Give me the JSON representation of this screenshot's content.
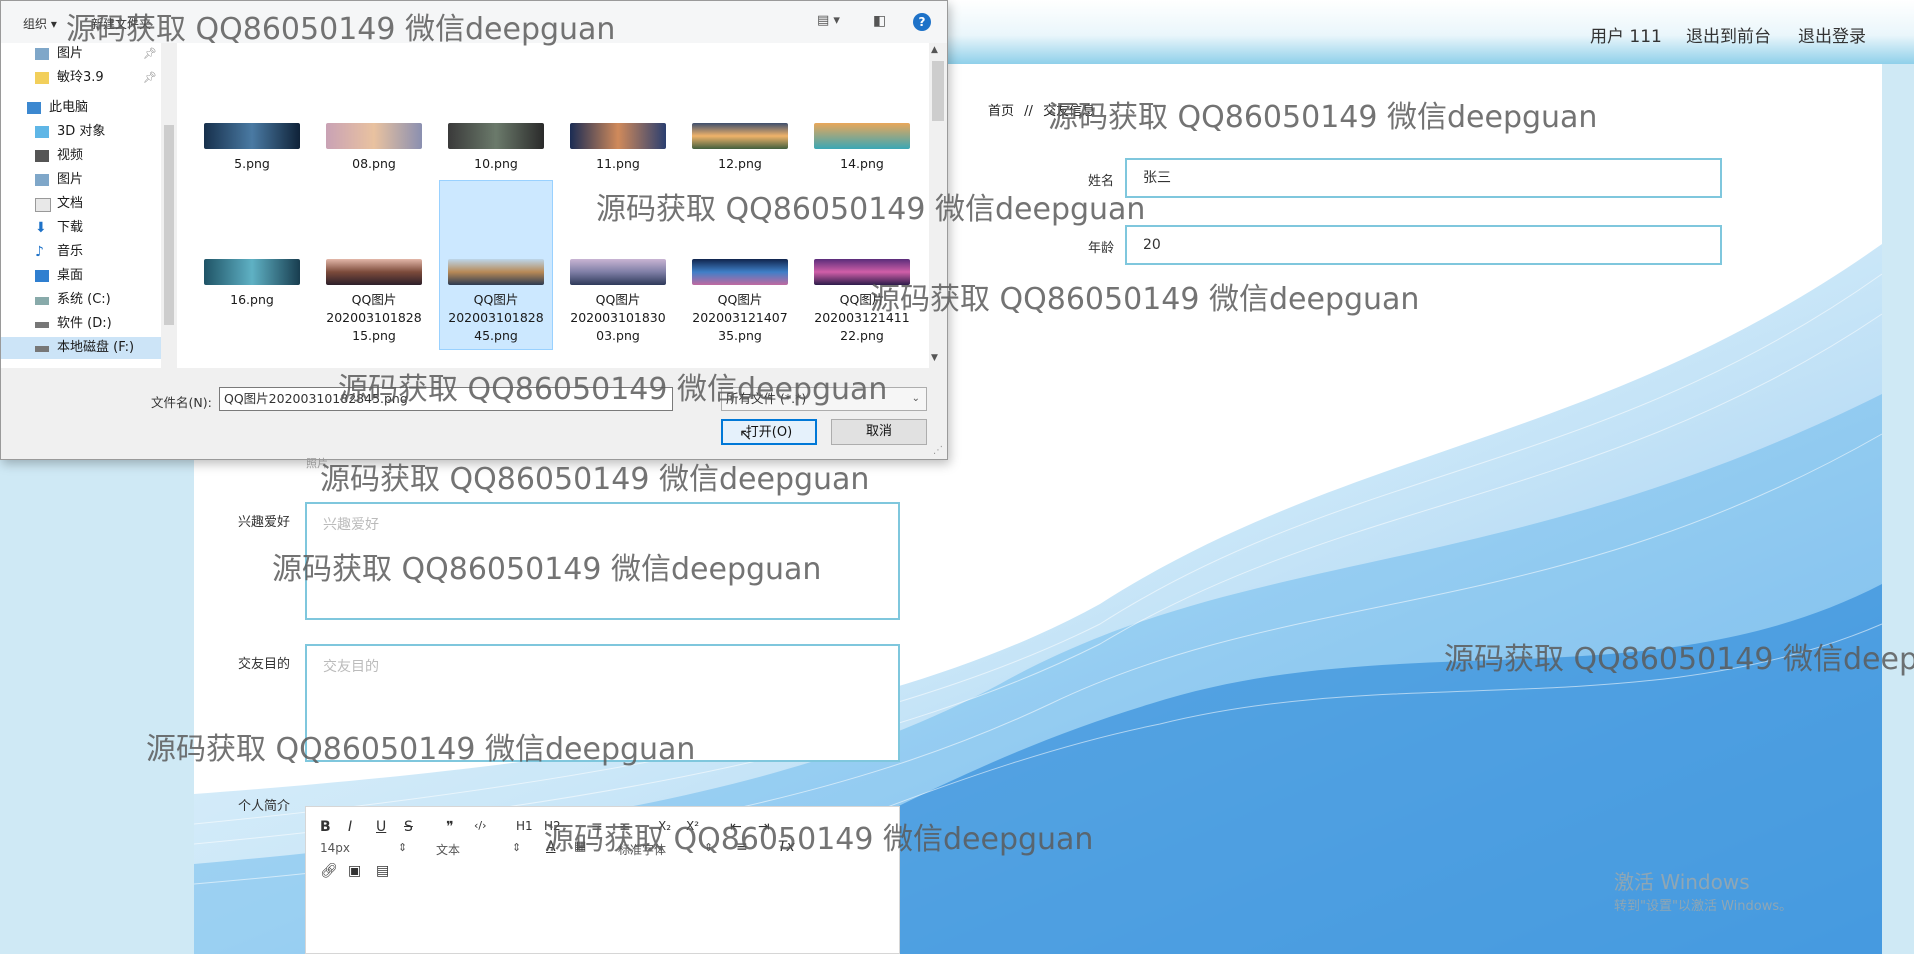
{
  "header": {
    "user": "用户 111",
    "to_front": "退出到前台",
    "logout": "退出登录"
  },
  "breadcrumb": {
    "home": "首页",
    "sep": "//",
    "current": "交友信息"
  },
  "form": {
    "name_label": "姓名",
    "name_value": "张三",
    "age_label": "年龄",
    "age_value": "20",
    "hobby_label": "兴趣爱好",
    "hobby_placeholder": "兴趣爱好",
    "purpose_label": "交友目的",
    "purpose_placeholder": "交友目的",
    "intro_label": "个人简介",
    "photo_label_partial": "照片"
  },
  "editor": {
    "font_size": "14px",
    "para": "文本",
    "font_family": "标准字体",
    "tools": [
      "B",
      "I",
      "U",
      "S",
      "❞",
      "‹/›",
      "H1",
      "H2",
      "≡",
      "≡",
      "X₂",
      "X²",
      "⇤",
      "⇥"
    ]
  },
  "os": {
    "activate_title": "激活 Windows",
    "activate_sub": "转到\"设置\"以激活 Windows。"
  },
  "dialog": {
    "organize": "组织 ▾",
    "new_folder": "新建文件夹",
    "nav": [
      {
        "label": "图片",
        "pinned": true,
        "icon": "pictures-icon"
      },
      {
        "label": "敏玲3.9",
        "pinned": true,
        "icon": "folder-icon"
      },
      {
        "label": "此电脑",
        "icon": "computer-icon"
      },
      {
        "label": "3D 对象",
        "icon": "3d-objects-icon"
      },
      {
        "label": "视频",
        "icon": "video-icon"
      },
      {
        "label": "图片",
        "icon": "pictures-icon"
      },
      {
        "label": "文档",
        "icon": "documents-icon"
      },
      {
        "label": "下载",
        "icon": "download-icon"
      },
      {
        "label": "音乐",
        "icon": "music-icon"
      },
      {
        "label": "桌面",
        "icon": "desktop-icon"
      },
      {
        "label": "系统 (C:)",
        "icon": "drive-icon"
      },
      {
        "label": "软件 (D:)",
        "icon": "drive-icon"
      },
      {
        "label": "本地磁盘 (F:)",
        "icon": "drive-icon"
      }
    ],
    "files_row1": [
      "5.png",
      "08.png",
      "10.png",
      "11.png",
      "12.png",
      "14.png"
    ],
    "files_row2": [
      [
        "16.png"
      ],
      [
        "QQ图片",
        "202003101828",
        "15.png"
      ],
      [
        "QQ图片",
        "202003101828",
        "45.png"
      ],
      [
        "QQ图片",
        "202003101830",
        "03.png"
      ],
      [
        "QQ图片",
        "202003121407",
        "35.png"
      ],
      [
        "QQ图片",
        "202003121411",
        "22.png"
      ]
    ],
    "filename_label": "文件名(N):",
    "filename_value": "QQ图片20200310182845.png",
    "filter": "所有文件 (*.*)",
    "open_btn": "打开(O)",
    "cancel_btn": "取消"
  },
  "watermark": "源码获取 QQ86050149 微信deepguan"
}
